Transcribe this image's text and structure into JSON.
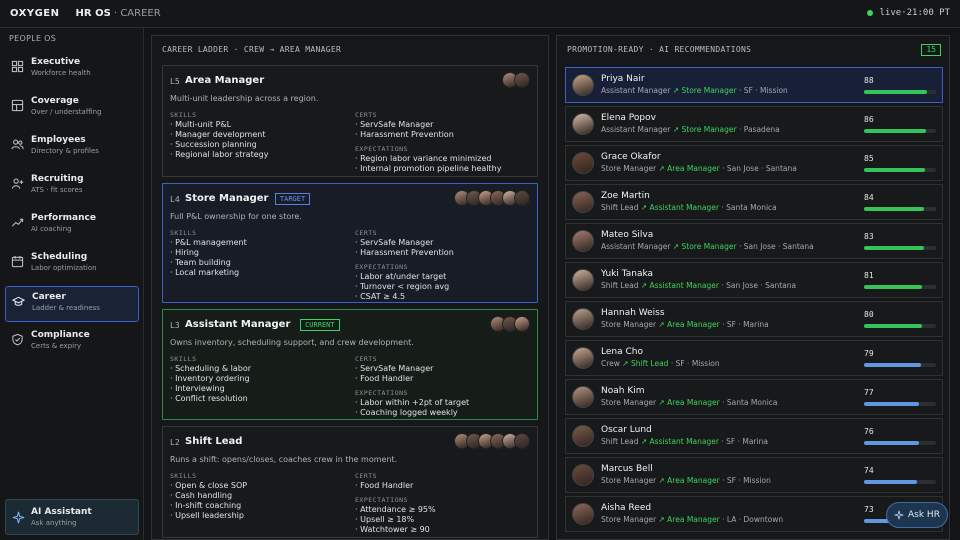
{
  "topbar": {
    "logo": "OXYGEN",
    "app": "HR OS",
    "sep": " · ",
    "section": "CAREER",
    "status": "live",
    "time": "21:00 PT",
    "status_sep": " · "
  },
  "sidebar": {
    "section": "PEOPLE OS",
    "items": [
      {
        "label": "Executive",
        "sub": "Workforce health",
        "icon": "grid-icon"
      },
      {
        "label": "Coverage",
        "sub": "Over / understaffing",
        "icon": "layout-icon"
      },
      {
        "label": "Employees",
        "sub": "Directory & profiles",
        "icon": "users-icon"
      },
      {
        "label": "Recruiting",
        "sub": "ATS · fit scores",
        "icon": "user-plus-icon"
      },
      {
        "label": "Performance",
        "sub": "AI coaching",
        "icon": "trend-icon"
      },
      {
        "label": "Scheduling",
        "sub": "Labor optimization",
        "icon": "calendar-icon"
      },
      {
        "label": "Career",
        "sub": "Ladder & readiness",
        "icon": "graduation-cap-icon",
        "active": true
      },
      {
        "label": "Compliance",
        "sub": "Certs & expiry",
        "icon": "shield-icon"
      }
    ],
    "assistant": {
      "label": "AI Assistant",
      "sub": "Ask anything",
      "icon": "sparkle-icon"
    }
  },
  "ladder": {
    "header": "CAREER LADDER · CREW → AREA MANAGER",
    "cards": [
      {
        "level": "L5",
        "name": "Area Manager",
        "tag": "",
        "desc": "Multi-unit leadership across a region.",
        "skills_label": "SKILLS",
        "skills": [
          "· Multi-unit P&L",
          "· Manager development",
          "· Succession planning",
          "· Regional labor strategy"
        ],
        "certs_label": "CERTS",
        "certs": [
          "· ServSafe Manager",
          "· Harassment Prevention"
        ],
        "exp_label": "EXPECTATIONS",
        "expectations": [
          "· Region labor variance minimized",
          "· Internal promotion pipeline healthy"
        ],
        "avatars": 2
      },
      {
        "level": "L4",
        "name": "Store Manager",
        "tag": "TARGET",
        "desc": "Full P&L ownership for one store.",
        "skills_label": "SKILLS",
        "skills": [
          "· P&L management",
          "· Hiring",
          "· Team building",
          "· Local marketing"
        ],
        "certs_label": "CERTS",
        "certs": [
          "· ServSafe Manager",
          "· Harassment Prevention"
        ],
        "exp_label": "EXPECTATIONS",
        "expectations": [
          "· Labor at/under target",
          "· Turnover < region avg",
          "· CSAT ≥ 4.5"
        ],
        "avatars": 6
      },
      {
        "level": "L3",
        "name": "Assistant Manager",
        "tag": "CURRENT",
        "desc": "Owns inventory, scheduling support, and crew development.",
        "skills_label": "SKILLS",
        "skills": [
          "· Scheduling & labor",
          "· Inventory ordering",
          "· Interviewing",
          "· Conflict resolution"
        ],
        "certs_label": "CERTS",
        "certs": [
          "· ServSafe Manager",
          "· Food Handler"
        ],
        "exp_label": "EXPECTATIONS",
        "expectations": [
          "· Labor within +2pt of target",
          "· Coaching logged weekly"
        ],
        "avatars": 3
      },
      {
        "level": "L2",
        "name": "Shift Lead",
        "tag": "",
        "desc": "Runs a shift: opens/closes, coaches crew in the moment.",
        "skills_label": "SKILLS",
        "skills": [
          "· Open & close SOP",
          "· Cash handling",
          "· In-shift coaching",
          "· Upsell leadership"
        ],
        "certs_label": "CERTS",
        "certs": [
          "· Food Handler"
        ],
        "exp_label": "EXPECTATIONS",
        "expectations": [
          "· Attendance ≥ 95%",
          "· Upsell ≥ 18%",
          "· Watchtower ≥ 90"
        ],
        "avatars": 6
      }
    ]
  },
  "promo": {
    "header": "PROMOTION-READY · AI RECOMMENDATIONS",
    "count": "15",
    "rows": [
      {
        "name": "Priya Nair",
        "role": "Assistant Manager",
        "arrow": "↗",
        "target": "Store Manager",
        "loc": "· SF · Mission",
        "score": "88",
        "pct": 88,
        "color": "green",
        "selected": true
      },
      {
        "name": "Elena Popov",
        "role": "Assistant Manager",
        "arrow": "↗",
        "target": "Store Manager",
        "loc": "· Pasadena",
        "score": "86",
        "pct": 86,
        "color": "green"
      },
      {
        "name": "Grace Okafor",
        "role": "Store Manager",
        "arrow": "↗",
        "target": "Area Manager",
        "loc": "· San Jose · Santana",
        "score": "85",
        "pct": 85,
        "color": "green"
      },
      {
        "name": "Zoe Martin",
        "role": "Shift Lead",
        "arrow": "↗",
        "target": "Assistant Manager",
        "loc": "· Santa Monica",
        "score": "84",
        "pct": 84,
        "color": "green"
      },
      {
        "name": "Mateo Silva",
        "role": "Assistant Manager",
        "arrow": "↗",
        "target": "Store Manager",
        "loc": "· San Jose · Santana",
        "score": "83",
        "pct": 83,
        "color": "green"
      },
      {
        "name": "Yuki Tanaka",
        "role": "Shift Lead",
        "arrow": "↗",
        "target": "Assistant Manager",
        "loc": "· San Jose · Santana",
        "score": "81",
        "pct": 81,
        "color": "green"
      },
      {
        "name": "Hannah Weiss",
        "role": "Store Manager",
        "arrow": "↗",
        "target": "Area Manager",
        "loc": "· SF · Marina",
        "score": "80",
        "pct": 80,
        "color": "green"
      },
      {
        "name": "Lena Cho",
        "role": "Crew",
        "arrow": "↗",
        "target": "Shift Lead",
        "loc": "· SF · Mission",
        "score": "79",
        "pct": 79,
        "color": "blue"
      },
      {
        "name": "Noah Kim",
        "role": "Store Manager",
        "arrow": "↗",
        "target": "Area Manager",
        "loc": "· Santa Monica",
        "score": "77",
        "pct": 77,
        "color": "blue"
      },
      {
        "name": "Oscar Lund",
        "role": "Shift Lead",
        "arrow": "↗",
        "target": "Assistant Manager",
        "loc": "· SF · Marina",
        "score": "76",
        "pct": 76,
        "color": "blue"
      },
      {
        "name": "Marcus Bell",
        "role": "Store Manager",
        "arrow": "↗",
        "target": "Area Manager",
        "loc": "· SF · Mission",
        "score": "74",
        "pct": 74,
        "color": "blue"
      },
      {
        "name": "Aisha Reed",
        "role": "Store Manager",
        "arrow": "↗",
        "target": "Area Manager",
        "loc": "· LA · Downtown",
        "score": "73",
        "pct": 73,
        "color": "blue"
      }
    ]
  },
  "ask_hr": {
    "label": "Ask HR",
    "icon": "sparkle-icon"
  },
  "colors": {
    "accent_blue": "#3d5fcc",
    "green": "#3ed35f",
    "bar_green": "#35c45a",
    "bar_blue": "#5f97e0"
  }
}
